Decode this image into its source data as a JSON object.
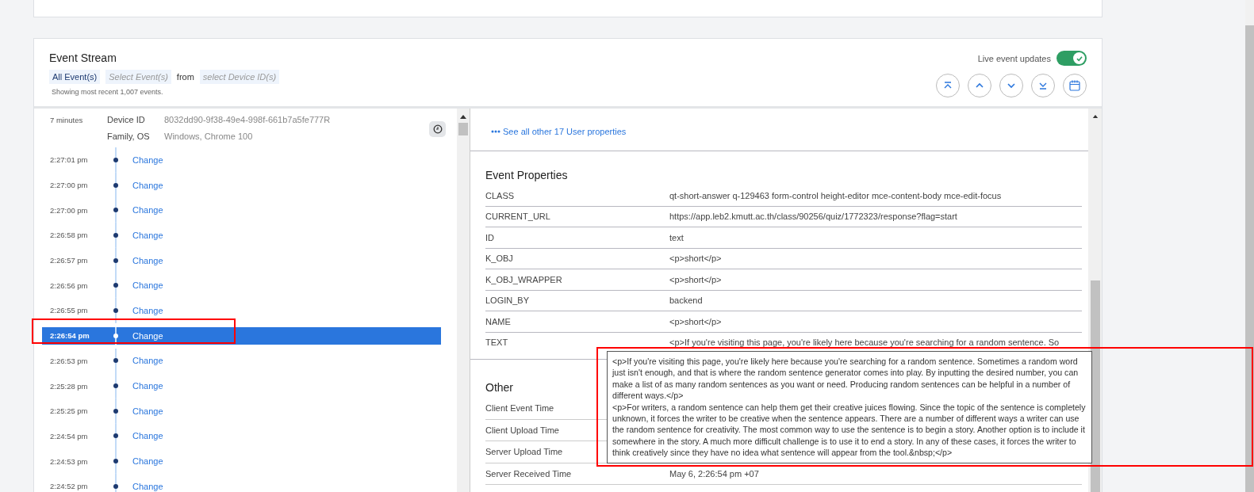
{
  "panel": {
    "title": "Event Stream",
    "filters": [
      {
        "label": "All Event(s)",
        "kind": "value"
      },
      {
        "label": "Select Event(s)",
        "kind": "placeholder"
      },
      {
        "label": "from",
        "kind": "text"
      },
      {
        "label": "select Device ID(s)",
        "kind": "placeholder"
      }
    ],
    "caption": "Showing most recent 1,007 events.",
    "live_updates": {
      "label": "Live event updates",
      "on": true
    }
  },
  "session": {
    "age": "7 minutes",
    "fields": [
      {
        "label": "Device ID",
        "value": "8032dd90-9f38-49e4-998f-661b7a5fe777R"
      },
      {
        "label": "Family, OS",
        "value": "Windows, Chrome 100"
      }
    ]
  },
  "events": [
    {
      "time": "2:27:01 pm",
      "name": "Change",
      "selected": false
    },
    {
      "time": "2:27:00 pm",
      "name": "Change",
      "selected": false
    },
    {
      "time": "2:27:00 pm",
      "name": "Change",
      "selected": false
    },
    {
      "time": "2:26:58 pm",
      "name": "Change",
      "selected": false
    },
    {
      "time": "2:26:57 pm",
      "name": "Change",
      "selected": false
    },
    {
      "time": "2:26:56 pm",
      "name": "Change",
      "selected": false
    },
    {
      "time": "2:26:55 pm",
      "name": "Change",
      "selected": false
    },
    {
      "time": "2:26:54 pm",
      "name": "Change",
      "selected": true
    },
    {
      "time": "2:26:53 pm",
      "name": "Change",
      "selected": false
    },
    {
      "time": "2:25:28 pm",
      "name": "Change",
      "selected": false
    },
    {
      "time": "2:25:25 pm",
      "name": "Change",
      "selected": false
    },
    {
      "time": "2:24:54 pm",
      "name": "Change",
      "selected": false
    },
    {
      "time": "2:24:53 pm",
      "name": "Change",
      "selected": false
    },
    {
      "time": "2:24:52 pm",
      "name": "Change",
      "selected": false
    }
  ],
  "details": {
    "more_link": "See all other 17 User properties",
    "event_properties": {
      "title": "Event Properties",
      "rows": [
        {
          "label": "CLASS",
          "value": "qt-short-answer q-129463 form-control height-editor mce-content-body mce-edit-focus"
        },
        {
          "label": "CURRENT_URL",
          "value": "https://app.leb2.kmutt.ac.th/class/90256/quiz/1772323/response?flag=start"
        },
        {
          "label": "ID",
          "value": "text"
        },
        {
          "label": "K_OBJ",
          "value": "<p>short</p>"
        },
        {
          "label": "K_OBJ_WRAPPER",
          "value": "<p>short</p>"
        },
        {
          "label": "LOGIN_BY",
          "value": "backend"
        },
        {
          "label": "NAME",
          "value": "<p>short</p>"
        },
        {
          "label": "TEXT",
          "value": "<p>If you're visiting this page, you're likely here because you're searching for a random sentence. So"
        }
      ]
    },
    "other": {
      "title": "Other",
      "rows": [
        {
          "label": "Client Event Time"
        },
        {
          "label": "Client Upload Time"
        },
        {
          "label": "Server Upload Time"
        },
        {
          "label": "Server Received Time",
          "value": "May 6, 2:26:54 pm +07"
        }
      ]
    }
  },
  "tooltip": {
    "paragraphs": [
      "<p>If you're visiting this page, you're likely here because you're searching for a random sentence. Sometimes a random word just isn't enough, and that is where the random sentence generator comes into play. By inputting the desired number, you can make a list of as many random sentences as you want or need. Producing random sentences can be helpful in a number of different ways.</p>",
      "<p>For writers, a random sentence can help them get their creative juices flowing. Since the topic of the sentence is completely unknown, it forces the writer to be creative when the sentence appears. There are a number of different ways a writer can use the random sentence for creativity. The most common way to use the sentence is to begin a story. Another option is to include it somewhere in the story. A much more difficult challenge is to use it to end a story. In any of these cases, it forces the writer to think creatively since they have no idea what sentence will appear from the tool.&nbsp;</p>"
    ]
  }
}
